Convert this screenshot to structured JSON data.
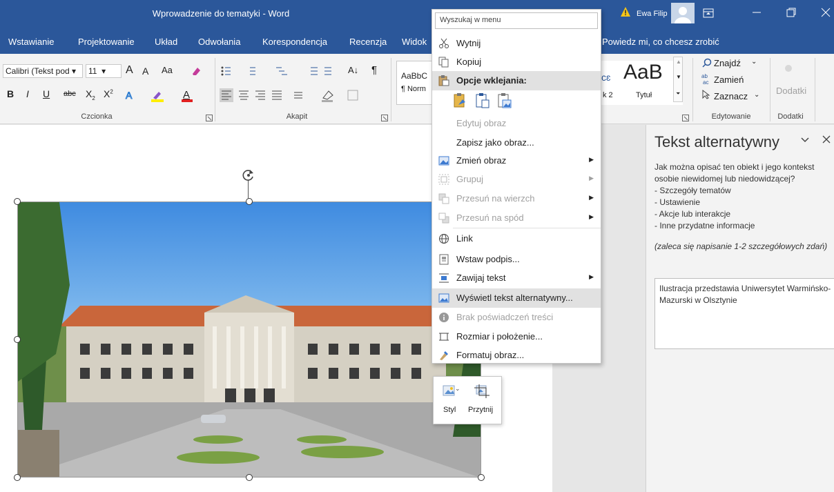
{
  "window": {
    "title": "Wprowadzenie do tematyki - Word",
    "user": "Ewa Filip"
  },
  "tabs": [
    "Wstawianie",
    "Projektowanie",
    "Układ",
    "Odwołania",
    "Korespondencja",
    "Recenzja",
    "Widok"
  ],
  "tellme": "Powiedz mi, co chcesz zrobić",
  "ribbon": {
    "font_name": "Calibri (Tekst pod",
    "font_size": "11",
    "grow": "A",
    "shrink": "A",
    "case": "Aa",
    "bold": "B",
    "italic": "I",
    "underline": "U",
    "strike": "abc",
    "subscript": "X",
    "subscript_mark": "2",
    "superscript": "X",
    "superscript_mark": "2",
    "font_group": "Czcionka",
    "para_group": "Akapit",
    "sort": "A↓",
    "pilcrow": "¶",
    "styles": {
      "s1_sample": "AaBbC",
      "s1_name": "¶ Norm",
      "s2_sample": "cɛ",
      "s2_name": "k 2",
      "s3_sample": "AaB",
      "s3_name": "Tytuł"
    },
    "edit": {
      "find": "Znajdź",
      "replace": "Zamień",
      "select": "Zaznacz",
      "group": "Edytowanie"
    },
    "addins": {
      "button": "Dodatki",
      "group": "Dodatki"
    }
  },
  "menu": {
    "search_placeholder": "Wyszukaj w menu",
    "items": [
      {
        "label": "Wytnij",
        "icon": "scissors-icon"
      },
      {
        "label": "Kopiuj",
        "icon": "copy-icon"
      },
      {
        "label": "Opcje wklejania:",
        "icon": "paste-icon"
      },
      {
        "label": "Edytuj obraz",
        "icon": ""
      },
      {
        "label": "Zapisz jako obraz...",
        "icon": ""
      },
      {
        "label": "Zmień obraz",
        "icon": "change-picture-icon"
      },
      {
        "label": "Grupuj",
        "icon": "group-icon"
      },
      {
        "label": "Przesuń na wierzch",
        "icon": "bring-front-icon"
      },
      {
        "label": "Przesuń na spód",
        "icon": "send-back-icon"
      },
      {
        "label": "Link",
        "icon": "link-icon"
      },
      {
        "label": "Wstaw podpis...",
        "icon": "caption-icon"
      },
      {
        "label": "Zawijaj tekst",
        "icon": "wrap-icon"
      },
      {
        "label": "Wyświetl tekst alternatywny...",
        "icon": "alt-text-icon"
      },
      {
        "label": "Brak poświadczeń treści",
        "icon": "info-icon"
      },
      {
        "label": "Rozmiar i położenie...",
        "icon": "size-icon"
      },
      {
        "label": "Formatuj obraz...",
        "icon": "format-icon"
      }
    ]
  },
  "minitoolbar": {
    "style": "Styl",
    "crop": "Przytnij"
  },
  "pane": {
    "title": "Tekst alternatywny",
    "prompt": "Jak można opisać ten obiekt i jego kontekst osobie niewidomej lub niedowidzącej?",
    "bullets": [
      "- Szczegóły tematów",
      "- Ustawienie",
      "- Akcje lub interakcje",
      "- Inne przydatne informacje"
    ],
    "hint": "(zaleca się napisanie 1-2 szczegółowych zdań)",
    "value": "Ilustracja przedstawia Uniwersytet Warmińsko-Mazurski w Olsztynie"
  },
  "colors": {
    "brand": "#2b579a",
    "highlight": "#e1e1e1"
  }
}
